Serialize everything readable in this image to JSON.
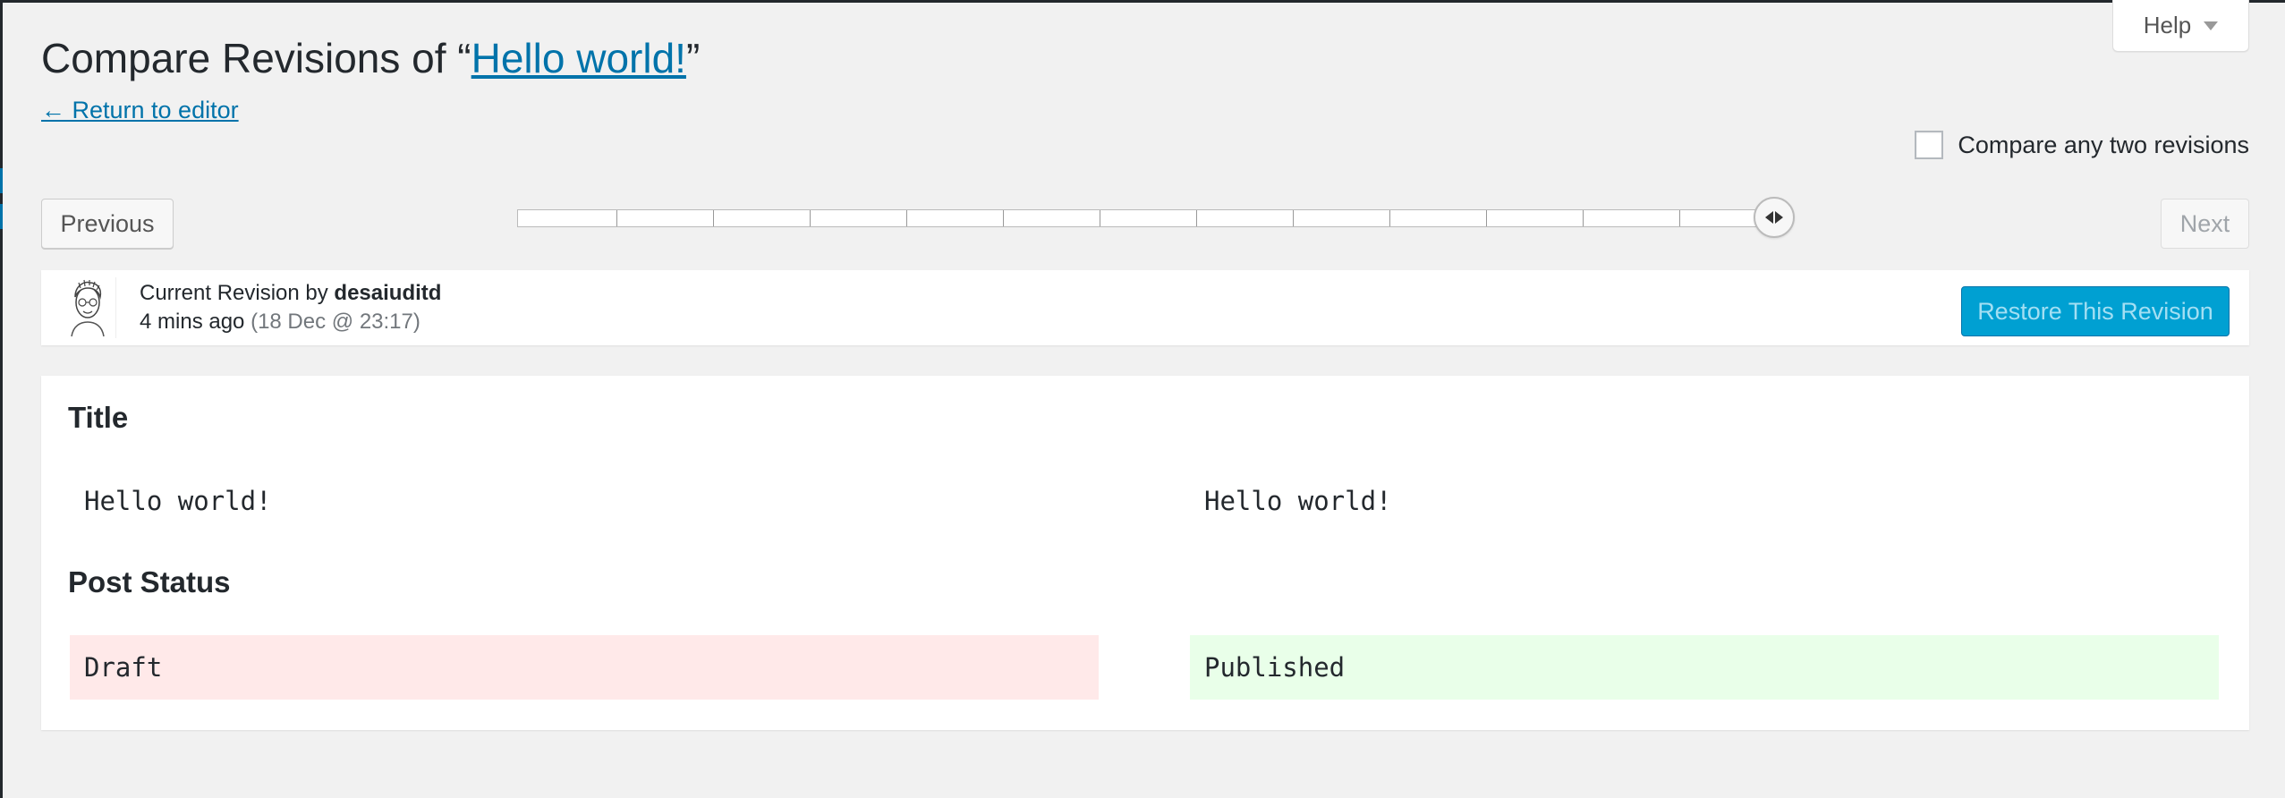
{
  "help": {
    "label": "Help"
  },
  "header": {
    "title_prefix": "Compare Revisions of “",
    "title_link": "Hello world!",
    "title_suffix": "”",
    "return_link": "← Return to editor"
  },
  "compare_any": {
    "label": "Compare any two revisions",
    "checked": false
  },
  "nav": {
    "previous": "Previous",
    "next": "Next",
    "slider_position": 1.0
  },
  "revision_meta": {
    "prefix": "Current Revision by ",
    "author": "desaiuditd",
    "time_ago": "4 mins ago",
    "date": "(18 Dec @ 23:17)",
    "restore_button": "Restore This Revision"
  },
  "diff": {
    "sections": [
      {
        "heading": "Title",
        "left": "Hello world!",
        "right": "Hello world!"
      },
      {
        "heading": "Post Status",
        "left": "Draft",
        "right": "Published"
      }
    ]
  },
  "colors": {
    "link": "#0073aa",
    "primary_button": "#00a0d2",
    "deleted_bg": "#ffe9e9",
    "added_bg": "#e9ffe9"
  }
}
